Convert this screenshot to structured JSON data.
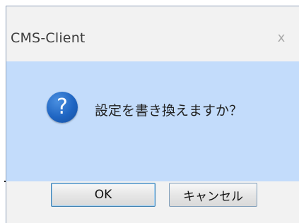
{
  "window": {
    "title": "CMS-Client",
    "close_glyph": "x"
  },
  "dialog": {
    "icon": "question-icon",
    "icon_glyph": "?",
    "message": "設定を書き換えますか？"
  },
  "buttons": {
    "ok_label": "OK",
    "cancel_label": "キャンセル"
  },
  "colors": {
    "content_background": "#c3dcfb",
    "icon_blue": "#1f65c2"
  }
}
